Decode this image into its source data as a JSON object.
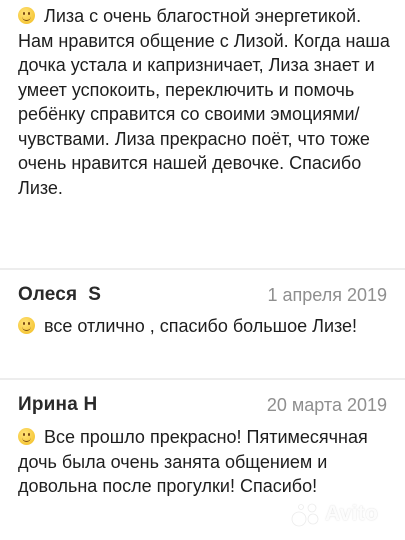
{
  "reviews": [
    {
      "text": "Лиза с очень благостной энергетикой. Нам нравится общение с Лизой. Когда наша дочка устала и капризничает, Лиза знает и умеет успокоить, переключить и помочь ребёнку справится со своими эмоциями/чувствами. Лиза прекрасно поёт, что тоже очень нравится нашей девочке. Спасибо Лизе.",
      "emoji": "smiley-emoji"
    },
    {
      "author": "Олеся  S",
      "date": "1 апреля 2019",
      "text": "все отлично , спасибо большое Лизе!",
      "emoji": "smiley-emoji"
    },
    {
      "author": "Ирина Н",
      "date": "20 марта 2019",
      "text": "Все прошло прекрасно! Пятимесячная дочь была очень занята общением и довольна после прогулки! Спасибо!",
      "emoji": "smiley-emoji"
    }
  ],
  "watermark": {
    "text": "Avito",
    "icon": "avito-logo-icon"
  },
  "colors": {
    "separator": "#ededed",
    "date": "#8f8f8f",
    "text": "#1e1e1e",
    "emoji": "#f6c83a"
  }
}
